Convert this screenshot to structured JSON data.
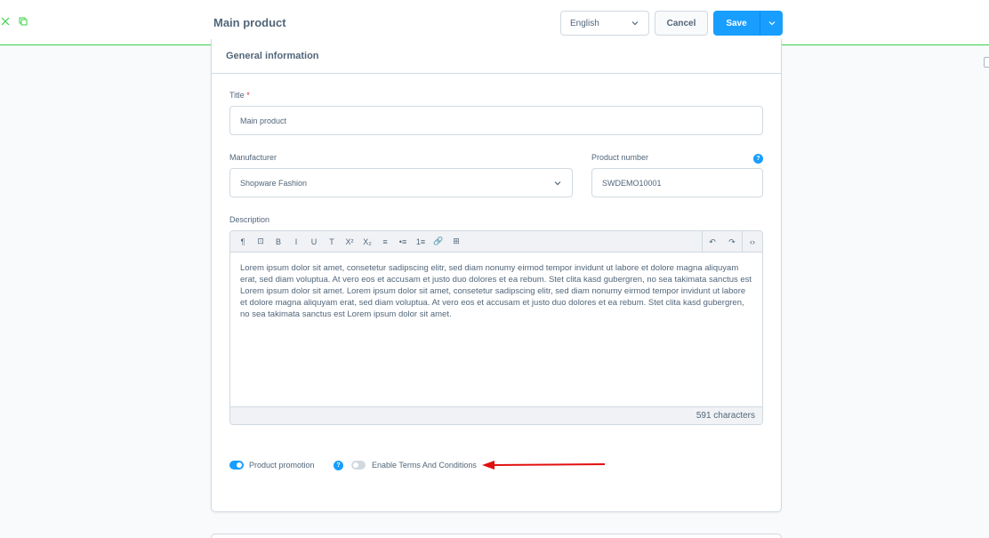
{
  "header": {
    "title": "Main product",
    "language": "English",
    "cancel_label": "Cancel",
    "save_label": "Save"
  },
  "card": {
    "title": "General information",
    "fields": {
      "title_label": "Title",
      "title_required": "*",
      "title_value": "Main product",
      "manufacturer_label": "Manufacturer",
      "manufacturer_value": "Shopware Fashion",
      "product_number_label": "Product number",
      "product_number_value": "SWDEMO10001",
      "description_label": "Description"
    },
    "editor": {
      "toolbar": [
        "¶",
        "⊡",
        "B",
        "I",
        "U",
        "T",
        "X²",
        "X₂",
        "≡",
        "•≡",
        "1≡",
        "🔗",
        "⊞"
      ],
      "toolbar_right": [
        "↶",
        "↷",
        "‹›"
      ],
      "content": "Lorem ipsum dolor sit amet, consetetur sadipscing elitr, sed diam nonumy eirmod tempor invidunt ut labore et dolore magna aliquyam erat, sed diam voluptua. At vero eos et accusam et justo duo dolores et ea rebum. Stet clita kasd gubergren, no sea takimata sanctus est Lorem ipsum dolor sit amet. Lorem ipsum dolor sit amet, consetetur sadipscing elitr, sed diam nonumy eirmod tempor invidunt ut labore et dolore magna aliquyam erat, sed diam voluptua. At vero eos et accusam et justo duo dolores et ea rebum. Stet clita kasd gubergren, no sea takimata sanctus est Lorem ipsum dolor sit amet.",
      "char_count": "591 characters"
    },
    "switches": {
      "promotion_label": "Product promotion",
      "promotion_on": true,
      "terms_label": "Enable Terms And Conditions",
      "terms_on": false,
      "help_glyph": "?"
    }
  },
  "colors": {
    "accent": "#189eff",
    "topbar_border": "#37d046",
    "arrow": "#e20f0f"
  }
}
